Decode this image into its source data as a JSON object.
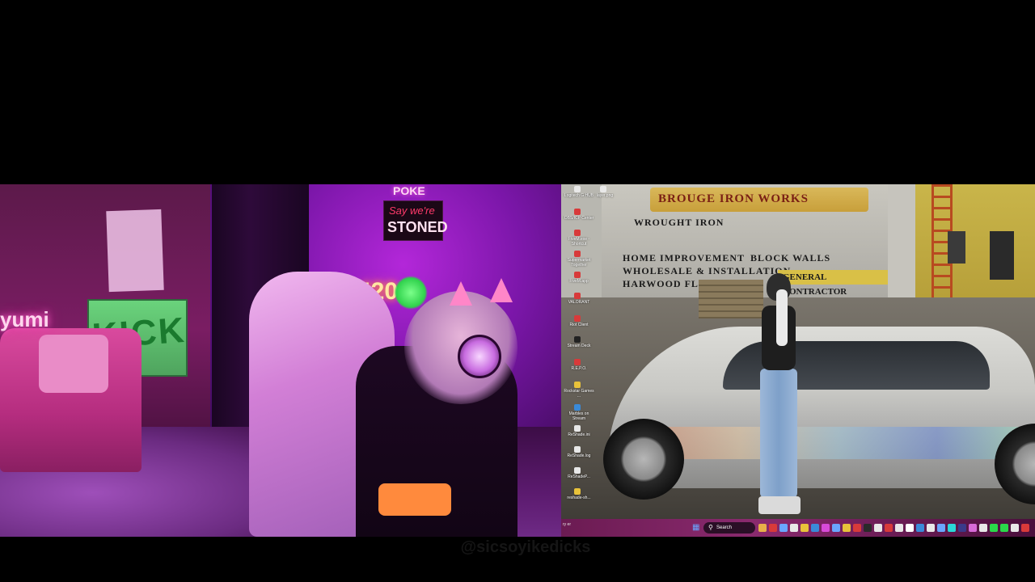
{
  "webcam": {
    "neon_name": "yumi",
    "kick_sign": "KICK",
    "sign_line1": "Say we're",
    "sign_line2": "STONED",
    "neon_top": "POKE",
    "neon_420": "420"
  },
  "game": {
    "wall_title": "BROUGE IRON WORKS",
    "wall_lines": [
      "WROUGHT IRON",
      "HOME IMPROVEMENT",
      "BLOCK WALLS",
      "WHOLESALE & INSTALLATION",
      "HARWOOD FLOORS"
    ],
    "contractor_sign": "GENERAL CONTRACTOR"
  },
  "desktop": {
    "icons": [
      {
        "label": "Logitech G HUB",
        "color": "#e8e8e8"
      },
      {
        "label": "layer.png",
        "color": "#e8e8e8"
      },
      {
        "label": "OBS/ICP Center",
        "color": "#d83a3a"
      },
      {
        "label": "FiveM.exe - Shortcut",
        "color": "#d83a3a"
      },
      {
        "label": "Supermarket Together",
        "color": "#d83a3a"
      },
      {
        "label": "FiveM.app",
        "color": "#d83a3a"
      },
      {
        "label": "VALORANT",
        "color": "#d83a3a"
      },
      {
        "label": "Riot Client",
        "color": "#d83a3a"
      },
      {
        "label": "Stream Deck",
        "color": "#222222"
      },
      {
        "label": "R.E.P.O.",
        "color": "#d83a3a"
      },
      {
        "label": "Rockstar Games ...",
        "color": "#e8c23a"
      },
      {
        "label": "Marbles on Stream",
        "color": "#3a8ad8"
      },
      {
        "label": "ReShade.ini",
        "color": "#e8e8e8"
      },
      {
        "label": "ReShade.log",
        "color": "#e8e8e8"
      },
      {
        "label": "ReShadeP...",
        "color": "#e8e8e8"
      },
      {
        "label": "reshade-sh...",
        "color": "#e8c23a"
      }
    ]
  },
  "taskbar": {
    "search_label": "Search",
    "left_text": "ry er",
    "apps": [
      "#e8b04a",
      "#d83a3a",
      "#6aa6ff",
      "#e8e8e8",
      "#e8c23a",
      "#3a8ad8",
      "#d84ad8",
      "#6aa6ff",
      "#e8c23a",
      "#d83a3a",
      "#2a2a2a",
      "#e8e8e8",
      "#d83a3a",
      "#e8e8e8",
      "#ffffff",
      "#3a8ad8",
      "#e8e8e8",
      "#6aa6ff",
      "#2ad8d8",
      "#3a3a8a",
      "#d86ad8",
      "#e8e8e8",
      "#2ad84a",
      "#2ad84a",
      "#e8e8e8",
      "#d83a3a"
    ]
  },
  "bottom_caption": "@sicsoyikedicks"
}
